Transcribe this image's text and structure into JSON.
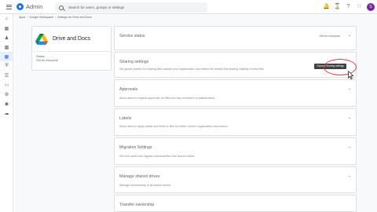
{
  "topbar": {
    "app_name": "Admin",
    "search_placeholder": "Search for users, groups or settings",
    "icons": [
      "menu-icon",
      "notifications-icon",
      "hourglass-icon",
      "help-icon",
      "apps-icon"
    ],
    "avatar_initial": "S",
    "avatar_color": "#7b1fa2"
  },
  "breadcrumb": [
    "Apps",
    "Google Workspace",
    "Settings for Drive and Docs"
  ],
  "left_rail": {
    "icons": [
      "home-icon",
      "dashboard-icon",
      "directory-icon",
      "devices-icon",
      "apps-icon",
      "security-icon",
      "reporting-icon",
      "billing-icon",
      "account-icon",
      "rules-icon",
      "storage-icon"
    ],
    "active_index": 4
  },
  "service": {
    "name": "Drive and Docs",
    "status_label": "Status",
    "status_value": "ON",
    "status_suffix": "for everyone"
  },
  "panels": [
    {
      "title": "Service status",
      "desc": "",
      "status_on": "ON",
      "status_suffix": "for everyone"
    },
    {
      "title": "Sharing settings",
      "desc": "Set global policies for sharing files outside your organization, and define the default link sharing visibility of new files",
      "tooltip": "Expand Sharing settings"
    },
    {
      "title": "Approvals",
      "desc": "Allow users to request approvals on files from key reviewers or stakeholders."
    },
    {
      "title": "Labels",
      "desc": "Allow users to apply labels and fields to files for better content organization and search."
    },
    {
      "title": "Migration Settings",
      "desc": "Set how users can migrate individual files into shared drives"
    },
    {
      "title": "Manage shared drives",
      "desc": "Manage membership of all shared drives"
    },
    {
      "title": "Transfer ownership",
      "desc": ""
    }
  ],
  "colors": {
    "accent": "#1a73e8",
    "on_green": "#188038",
    "highlight_red": "#e53935"
  }
}
